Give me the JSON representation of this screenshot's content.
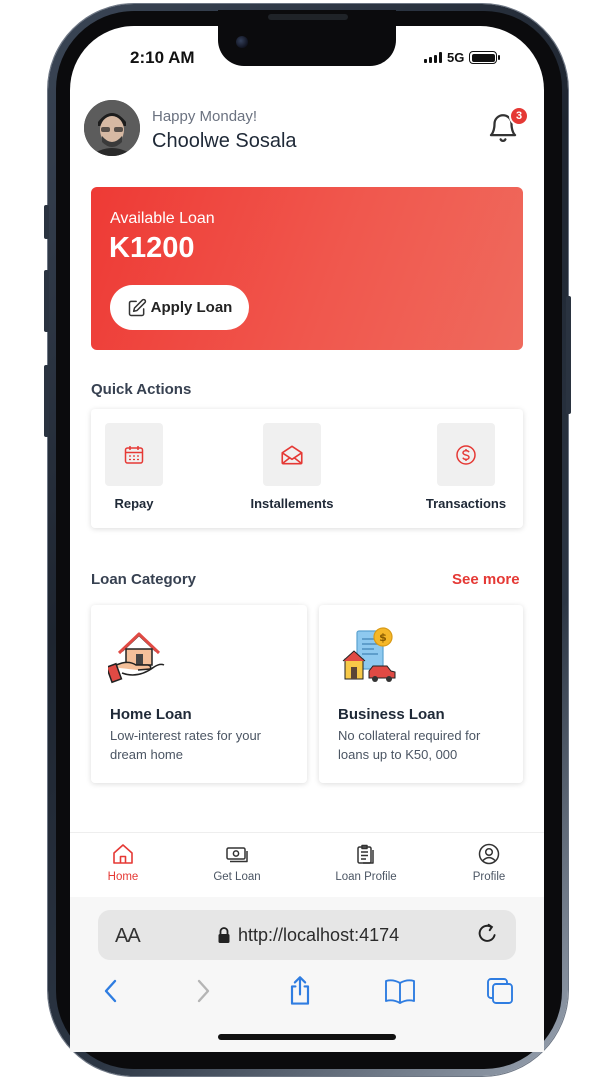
{
  "status_bar": {
    "time": "2:10 AM",
    "network": "5G"
  },
  "header": {
    "greeting": "Happy Monday!",
    "user_name": "Choolwe Sosala",
    "notification_count": "3"
  },
  "loan_card": {
    "label": "Available Loan",
    "amount": "K1200",
    "apply_label": "Apply Loan"
  },
  "quick_actions": {
    "title": "Quick Actions",
    "items": [
      {
        "label": "Repay",
        "icon": "calendar-icon"
      },
      {
        "label": "Installements",
        "icon": "envelope-icon"
      },
      {
        "label": "Transactions",
        "icon": "dollar-circle-icon"
      }
    ]
  },
  "loan_category": {
    "title": "Loan Category",
    "see_more": "See more",
    "items": [
      {
        "title": "Home Loan",
        "description": "Low-interest rates for your dream home",
        "icon": "house-hand-icon"
      },
      {
        "title": "Business Loan",
        "description": "No collateral required for loans up to K50, 000",
        "icon": "business-document-icon"
      }
    ]
  },
  "bottom_nav": {
    "items": [
      {
        "label": "Home",
        "icon": "home-icon",
        "active": true
      },
      {
        "label": "Get Loan",
        "icon": "money-icon",
        "active": false
      },
      {
        "label": "Loan Profile",
        "icon": "clipboard-icon",
        "active": false
      },
      {
        "label": "Profile",
        "icon": "user-circle-icon",
        "active": false
      }
    ]
  },
  "browser": {
    "text_size_label": "AA",
    "url": "http://localhost:4174"
  },
  "colors": {
    "accent": "#e53935",
    "card_gradient_start": "#ee3a35",
    "card_gradient_end": "#ef6a5d"
  }
}
